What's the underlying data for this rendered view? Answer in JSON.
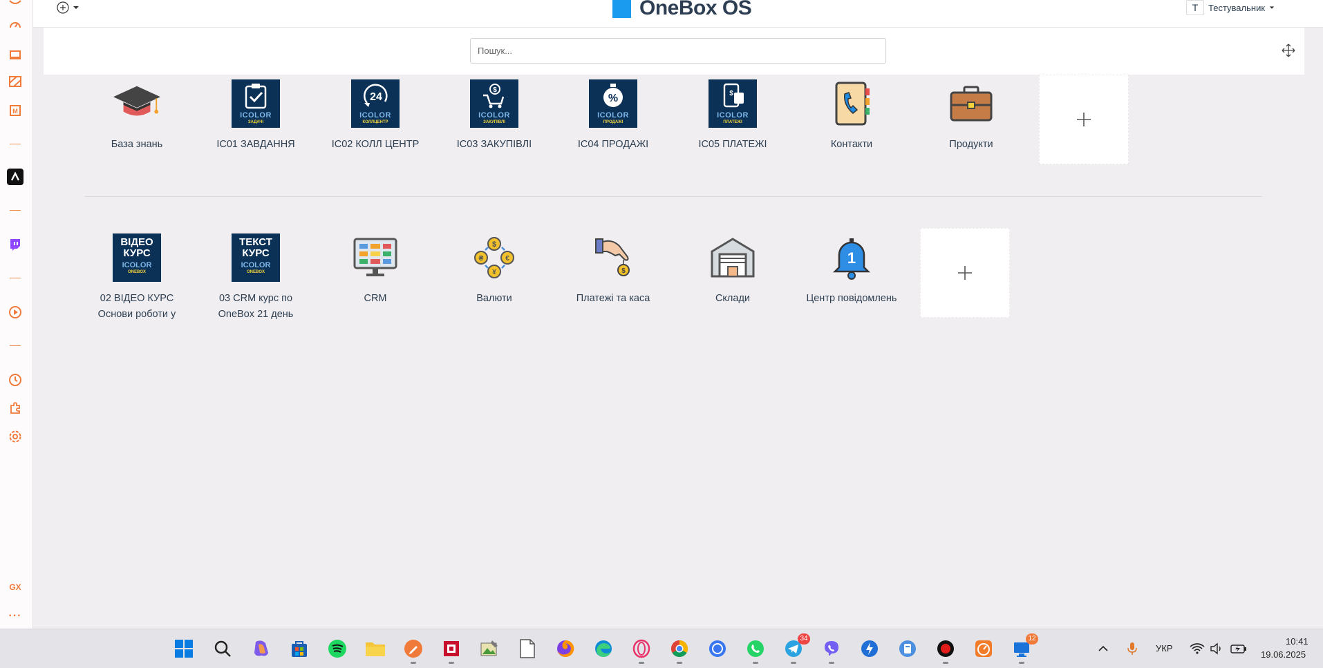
{
  "header": {
    "logo_text": "OneBox OS",
    "user_initial": "T",
    "user_name": "Тестувальник"
  },
  "search": {
    "placeholder": "Пошук..."
  },
  "groups": [
    {
      "tiles": [
        {
          "label": "База знань",
          "icon": "graduation-cap-icon"
        },
        {
          "label": "IC01 ЗАВДАННЯ",
          "icon": "icolor-tasks-icon",
          "brand": "ICOLOR",
          "sub": "ЗАДАЧІ"
        },
        {
          "label": "IC02 КОЛЛ ЦЕНТР",
          "icon": "icolor-callcenter-icon",
          "brand": "ICOLOR",
          "sub": "КОЛЛЦЕНТР"
        },
        {
          "label": "IC03 ЗАКУПІВЛІ",
          "icon": "icolor-purchases-icon",
          "brand": "ICOLOR",
          "sub": "ЗАКУПІВЛІ"
        },
        {
          "label": "IC04 ПРОДАЖІ",
          "icon": "icolor-sales-icon",
          "brand": "ICOLOR",
          "sub": "ПРОДАЖІ"
        },
        {
          "label": "IC05 ПЛАТЕЖІ",
          "icon": "icolor-payments-icon",
          "brand": "ICOLOR",
          "sub": "ПЛАТЕЖІ"
        },
        {
          "label": "Контакти",
          "icon": "address-book-icon"
        },
        {
          "label": "Продукти",
          "icon": "briefcase-icon"
        }
      ]
    },
    {
      "tiles": [
        {
          "label": "02 ВІДЕО КУРС Основи роботи у",
          "icon": "video-course-icon",
          "line1": "ВІДЕО",
          "line2": "КУРС",
          "brand": "ICOLOR",
          "sub": "ONEBOX"
        },
        {
          "label": "03 CRM курс по OneBox 21 день",
          "icon": "text-course-icon",
          "line1": "ТЕКСТ",
          "line2": "КУРС",
          "brand": "ICOLOR",
          "sub": "ONEBOX"
        },
        {
          "label": "CRM",
          "icon": "crm-monitor-icon"
        },
        {
          "label": "Валюти",
          "icon": "currencies-icon"
        },
        {
          "label": "Платежі та каса",
          "icon": "payment-hand-icon"
        },
        {
          "label": "Склади",
          "icon": "warehouse-icon"
        },
        {
          "label": "Центр повідомлень",
          "icon": "notification-bell-icon"
        }
      ]
    }
  ],
  "taskbar": {
    "badges": {
      "telegram": "34",
      "remote": "12"
    },
    "language": "УКР",
    "time": "10:41",
    "date": "19.06.2025"
  },
  "sidebar": {
    "gx_label": "GX"
  },
  "colors": {
    "accent": "#1b9bf0",
    "gx_orange": "#f07a3a",
    "tile_dark": "#0c3156"
  }
}
